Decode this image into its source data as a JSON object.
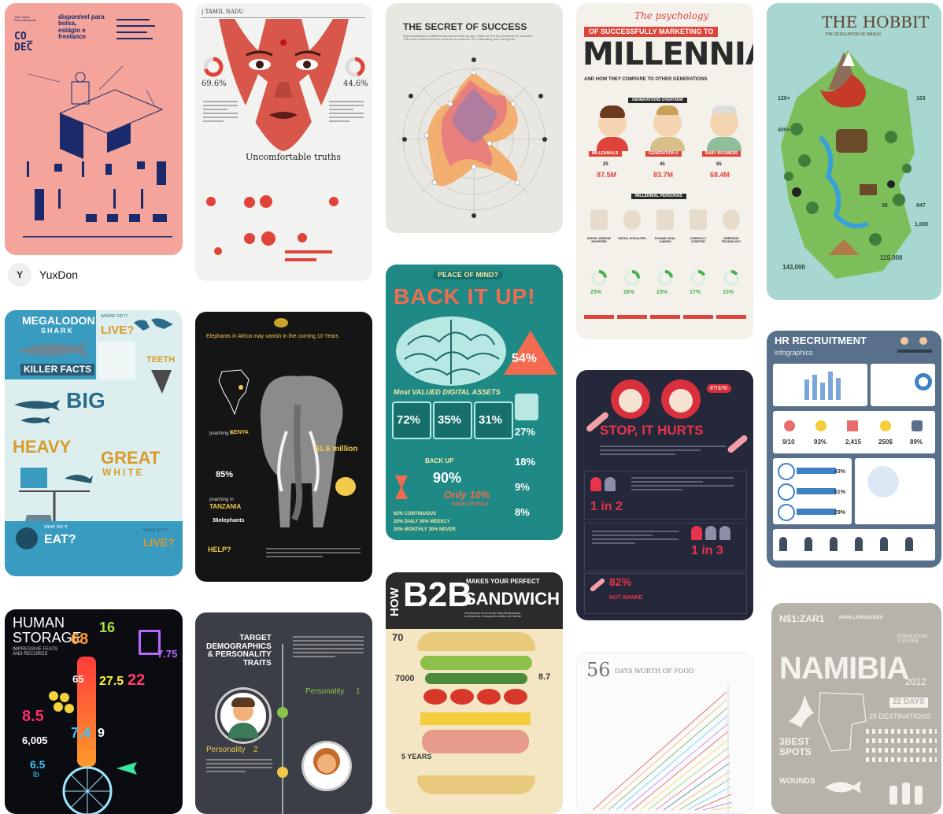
{
  "creator": {
    "avatar_letter": "Y",
    "name": "YuxDon"
  },
  "pins": {
    "codec": {
      "logo": "CO_\nDEC",
      "tagline": "disponível para\nbolsa,\nestágio e\nfreelance",
      "small_label": "Julio Vieira\nRosa Alexandre"
    },
    "tamil": {
      "header": "| TAMIL NADU",
      "pct_left": "69.6%",
      "pct_right": "44.6%",
      "title": "Uncomfortable truths"
    },
    "success": {
      "title": "THE SECRET OF SUCCESS",
      "subtitle": "Representations of different successful traits by age. What are the key elements for success?\nThis chart is based the the opinions of someone, it is misleading from the figures"
    },
    "millennials": {
      "script": "The psychology",
      "banner": "OF SUCCESSFULLY MARKETING TO",
      "big": "MILLENNIALS",
      "sub": "AND HOW THEY COMPARE TO OTHER GENERATIONS",
      "overview": "GENERATIONS OVERVIEW",
      "gens": [
        "MILLENNIALS",
        "GENERATION X",
        "BABY BOOMERS"
      ],
      "ages": [
        "25",
        "45",
        "65"
      ],
      "pops": [
        "87.5M",
        "83.7M",
        "68.4M"
      ],
      "personas": "MILLENNIAL PERSONAS",
      "persona_labels": [
        "DIGITAL WINDOW SHOPPERS",
        "DIGITAL SOCIALITES",
        "DYNAMIC DEAL JUNKIES",
        "CAREFULLY SCRIPTED",
        "EMERGING TECHNOLOGY"
      ],
      "percents": [
        "23%",
        "26%",
        "23%",
        "17%",
        "15%"
      ]
    },
    "hobbit": {
      "title": "THE HOBBIT",
      "subtitle": "THE DESOLATION OF SMAUG",
      "stats": [
        "120+",
        "400+",
        "1,000",
        "143,000",
        "115,000",
        "36",
        "947",
        "163"
      ]
    },
    "megalodon": {
      "title": "MEGALODON",
      "shark": "SHARK",
      "killer": "KILLER FACTS",
      "big": "BIG",
      "heavy": "HEAVY",
      "great": "GREAT",
      "white": "WHITE",
      "live": "LIVE?",
      "teeth": "TEETH",
      "eat": "EAT?",
      "live2": "LIVE?",
      "q1": "WHERE DID IT",
      "q2": "WHAT DID IT",
      "q3": "WHEN DID IT"
    },
    "elephants": {
      "title": "Elephants in Africa may vanish in the coming 10 Years",
      "kenya": "KENYA",
      "tanzania": "TANZANIA",
      "stat1": "85%",
      "stat2": "$1.6 million",
      "stat3": "36elephants",
      "help": "HELP?",
      "poaching": "poaching in"
    },
    "backup": {
      "peace": "PEACE OF MIND?",
      "title": "BACK IT UP!",
      "pct": "54%",
      "valued": "Most VALUED DIGITAL ASSETS",
      "p1": "72%",
      "p2": "35%",
      "p3": "31%",
      "side1": "27%",
      "side2": "18%",
      "side3": "9%",
      "side4": "8%",
      "big": "90%",
      "only": "Only 10%",
      "daily": "BACK UP DAILY",
      "backup_word": "BACK UP",
      "bottom": [
        "62% CONTINUOUS",
        "20% DAILY 30% WEEKLY",
        "20% MONTHLY 30% NEVER"
      ]
    },
    "hurts": {
      "title": "STOP, IT HURTS",
      "bubble": "#?!&%!",
      "stat1": "1 in 2",
      "stat2": "1 in 3",
      "stat3": "82%",
      "stat4": "NOT AWARE"
    },
    "hr": {
      "title": "HR RECRUITMENT",
      "sub": "infographics",
      "stats": [
        "9/10",
        "93%",
        "2,415",
        "250$",
        "89%"
      ],
      "rows": [
        "43%",
        "61%",
        "29%"
      ]
    },
    "human": {
      "title": "HUMAN\nSTORAGE",
      "sub": "IMPRESSIVE FEATS\nAND RECORDS",
      "n1": "68",
      "n2": "16",
      "n3": "7.75",
      "n4": "65",
      "n5": "27.5",
      "n6": "22",
      "n7": "8.5",
      "n8": "7.4",
      "n9": "9",
      "n10": "6,005",
      "n11": "6.5",
      "unit": "lb"
    },
    "target": {
      "title": "TARGET\nDEMOGRAPHICS\n& PERSONALITY\nTRAITS",
      "p1": "Personality",
      "n1": "1",
      "p2": "Personality",
      "n2": "2"
    },
    "b2b": {
      "how": "HOW",
      "b2b": "B2B",
      "makes": "MAKES YOUR PERFECT",
      "sandwich": "SANDWICH",
      "sub": "A Delicious Look at the Way Businesses\nto Business Companies Make Life Better",
      "n1": "70",
      "n2": "7000",
      "n3": "5 YEARS",
      "n4": "8.7"
    },
    "food": {
      "num": "56",
      "title": "DAYS WORTH OF FOOD"
    },
    "namibia": {
      "code": "N$1:ZAR1",
      "lang": "MAIN LANGUAGES",
      "pop": "POPULATION\n2 324 004",
      "title": "NAMIBIA",
      "year": "2012",
      "days": "22 DAYS",
      "dest": "25 DESTINATIONS",
      "best": "3BEST\nSPOTS",
      "wounds": "WOUNDS"
    }
  }
}
